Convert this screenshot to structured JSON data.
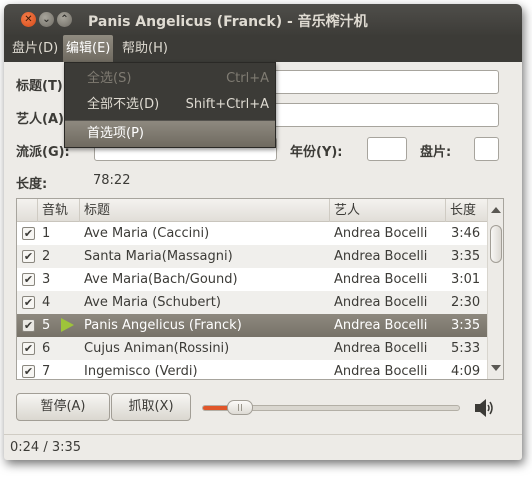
{
  "window": {
    "title": "Panis Angelicus (Franck) - 音乐榨汁机",
    "close_glyph": "✕",
    "min_glyph": "⌄",
    "max_glyph": "⌃"
  },
  "menubar": {
    "items": [
      {
        "label": "盘片(D)"
      },
      {
        "label": "编辑(E)"
      },
      {
        "label": "帮助(H)"
      }
    ]
  },
  "edit_menu": {
    "items": [
      {
        "label": "全选(S)",
        "accel": "Ctrl+A",
        "state": "disabled"
      },
      {
        "label": "全部不选(D)",
        "accel": "Shift+Ctrl+A",
        "state": "normal"
      },
      {
        "label": "首选项(P)",
        "accel": "",
        "state": "hover"
      }
    ]
  },
  "form": {
    "title_label": "标题(T)",
    "title_value": "",
    "artist_label": "艺人(A)",
    "artist_value": "",
    "genre_label": "流派(G):",
    "genre_value": "",
    "year_label": "年份(Y):",
    "year_value": "",
    "disc_label": "盘片:",
    "disc_value": "",
    "duration_label": "长度:",
    "duration_value": "78:22"
  },
  "tracklist": {
    "headers": {
      "track": "音轨",
      "title": "标题",
      "artist": "艺人",
      "length": "长度"
    },
    "check_glyph": "✔",
    "rows": [
      {
        "num": "1",
        "title": "Ave Maria (Caccini)",
        "artist": "Andrea Bocelli",
        "length": "3:46",
        "checked": true,
        "playing": false
      },
      {
        "num": "2",
        "title": "Santa Maria(Massagni)",
        "artist": "Andrea Bocelli",
        "length": "3:35",
        "checked": true,
        "playing": false
      },
      {
        "num": "3",
        "title": "Ave Maria(Bach/Gound)",
        "artist": "Andrea Bocelli",
        "length": "3:01",
        "checked": true,
        "playing": false
      },
      {
        "num": "4",
        "title": "Ave Maria (Schubert)",
        "artist": "Andrea Bocelli",
        "length": "2:30",
        "checked": true,
        "playing": false
      },
      {
        "num": "5",
        "title": "Panis Angelicus (Franck)",
        "artist": "Andrea Bocelli",
        "length": "3:35",
        "checked": true,
        "playing": true
      },
      {
        "num": "6",
        "title": "Cujus Animan(Rossini)",
        "artist": "Andrea Bocelli",
        "length": "5:33",
        "checked": true,
        "playing": false
      },
      {
        "num": "7",
        "title": "Ingemisco (Verdi)",
        "artist": "Andrea Bocelli",
        "length": "4:09",
        "checked": true,
        "playing": false
      }
    ]
  },
  "controls": {
    "pause_label": "暂停(A)",
    "extract_label": "抓取(X)",
    "seek_fraction": 0.113,
    "accent_color": "#e0562a",
    "speaker_icon": "volume-high-icon"
  },
  "status": {
    "text": "0:24 / 3:35"
  }
}
